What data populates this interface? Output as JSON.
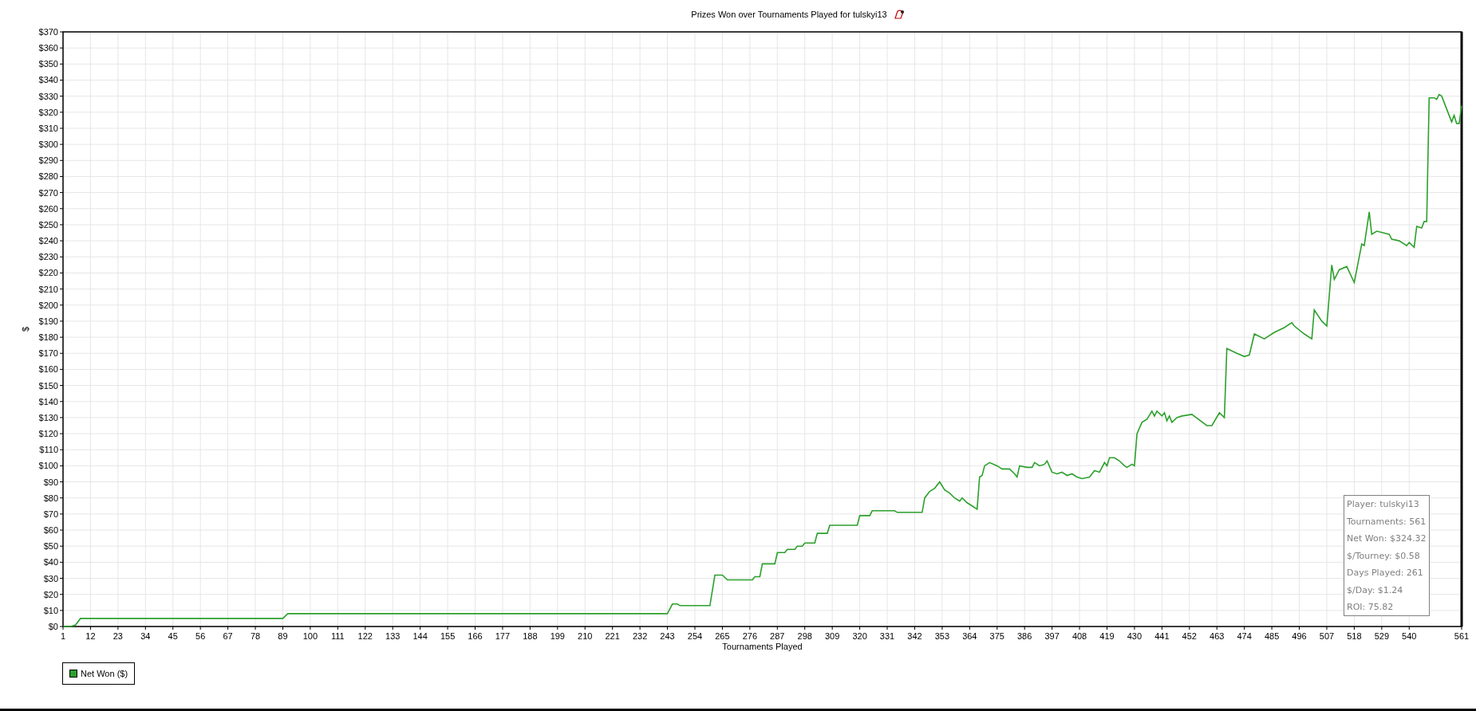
{
  "title": "Prizes Won over Tournaments Played for tulskyi13",
  "chart": {
    "chart_data": {
      "type": "line",
      "xlabel": "Tournaments Played",
      "ylabel": "$",
      "x": [
        1,
        4,
        6,
        8,
        89,
        91,
        243,
        245,
        247,
        248,
        260,
        262,
        265,
        267,
        277,
        278,
        280,
        281,
        286,
        287,
        290,
        291,
        294,
        295,
        297,
        298,
        302,
        303,
        307,
        308,
        319,
        320,
        324,
        325,
        334,
        335,
        345,
        346,
        348,
        350,
        352,
        354,
        356,
        358,
        360,
        361,
        363,
        365,
        367,
        368,
        369,
        370,
        372,
        375,
        377,
        380,
        382,
        383,
        384,
        387,
        389,
        390,
        392,
        394,
        395,
        397,
        399,
        401,
        403,
        405,
        407,
        409,
        412,
        414,
        416,
        418,
        419,
        420,
        422,
        424,
        426,
        427,
        429,
        430,
        431,
        433,
        435,
        437,
        438,
        439,
        441,
        442,
        443,
        444,
        445,
        447,
        449,
        453,
        459,
        461,
        464,
        466,
        467,
        471,
        474,
        476,
        478,
        482,
        486,
        490,
        493,
        494,
        498,
        501,
        502,
        505,
        507,
        509,
        510,
        512,
        515,
        518,
        521,
        522,
        524,
        525,
        527,
        532,
        533,
        536,
        539,
        540,
        542,
        543,
        545,
        546,
        547,
        548,
        550,
        551,
        552,
        553,
        557,
        558,
        559,
        560,
        561
      ],
      "series": [
        {
          "name": "Net Won ($)",
          "color": "#2ca02c",
          "values": [
            0,
            0,
            1,
            5,
            5,
            8,
            8,
            14,
            14,
            13,
            13,
            32,
            32,
            29,
            29,
            31,
            31,
            39,
            39,
            46,
            46,
            48,
            48,
            50,
            50,
            52,
            52,
            58,
            58,
            63,
            63,
            69,
            69,
            72,
            72,
            71,
            71,
            80,
            84,
            86,
            90,
            85,
            83,
            80,
            78,
            80,
            77,
            75,
            73,
            93,
            94,
            100,
            102,
            100,
            98,
            98,
            95,
            93,
            100,
            99,
            99,
            102,
            100,
            101,
            103,
            96,
            95,
            96,
            94,
            95,
            93,
            92,
            93,
            97,
            96,
            102,
            100,
            105,
            105,
            103,
            100,
            99,
            101,
            100,
            120,
            127,
            129,
            134,
            131,
            134,
            131,
            133,
            128,
            131,
            127,
            130,
            131,
            132,
            125,
            125,
            133,
            130,
            173,
            170,
            168,
            169,
            182,
            179,
            183,
            186,
            189,
            187,
            182,
            179,
            197,
            190,
            187,
            225,
            216,
            222,
            224,
            214,
            238,
            237,
            258,
            244,
            246,
            244,
            241,
            240,
            237,
            239,
            236,
            249,
            248,
            252,
            252,
            329,
            329,
            328,
            331,
            330,
            314,
            318,
            313,
            313,
            324
          ]
        }
      ],
      "grid": true,
      "xlim": [
        1,
        561
      ],
      "ylim": [
        0,
        370
      ],
      "xticks": [
        1,
        12,
        23,
        34,
        45,
        56,
        67,
        78,
        89,
        100,
        111,
        122,
        133,
        144,
        155,
        166,
        177,
        188,
        199,
        210,
        221,
        232,
        243,
        254,
        265,
        276,
        287,
        298,
        309,
        320,
        331,
        342,
        353,
        364,
        375,
        386,
        397,
        408,
        419,
        430,
        441,
        452,
        463,
        474,
        485,
        496,
        507,
        518,
        529,
        540,
        561
      ],
      "yticks": [
        {
          "value": 0,
          "label": "$0"
        },
        {
          "value": 10,
          "label": "$10"
        },
        {
          "value": 20,
          "label": "$20"
        },
        {
          "value": 30,
          "label": "$30"
        },
        {
          "value": 40,
          "label": "$40"
        },
        {
          "value": 50,
          "label": "$50"
        },
        {
          "value": 60,
          "label": "$60"
        },
        {
          "value": 70,
          "label": "$70"
        },
        {
          "value": 80,
          "label": "$80"
        },
        {
          "value": 90,
          "label": "$90"
        },
        {
          "value": 100,
          "label": "$100"
        },
        {
          "value": 110,
          "label": "$110"
        },
        {
          "value": 120,
          "label": "$120"
        },
        {
          "value": 130,
          "label": "$130"
        },
        {
          "value": 140,
          "label": "$140"
        },
        {
          "value": 150,
          "label": "$150"
        },
        {
          "value": 160,
          "label": "$160"
        },
        {
          "value": 170,
          "label": "$170"
        },
        {
          "value": 180,
          "label": "$180"
        },
        {
          "value": 190,
          "label": "$190"
        },
        {
          "value": 200,
          "label": "$200"
        },
        {
          "value": 210,
          "label": "$210"
        },
        {
          "value": 220,
          "label": "$220"
        },
        {
          "value": 230,
          "label": "$230"
        },
        {
          "value": 240,
          "label": "$240"
        },
        {
          "value": 250,
          "label": "$250"
        },
        {
          "value": 260,
          "label": "$260"
        },
        {
          "value": 270,
          "label": "$270"
        },
        {
          "value": 280,
          "label": "$280"
        },
        {
          "value": 290,
          "label": "$290"
        },
        {
          "value": 300,
          "label": "$300"
        },
        {
          "value": 310,
          "label": "$310"
        },
        {
          "value": 320,
          "label": "$320"
        },
        {
          "value": 330,
          "label": "$330"
        },
        {
          "value": 340,
          "label": "$340"
        },
        {
          "value": 350,
          "label": "$350"
        },
        {
          "value": 360,
          "label": "$360"
        },
        {
          "value": 370,
          "label": "$370"
        }
      ]
    },
    "stats_box": [
      "Player: tulskyi13",
      "Tournaments: 561",
      "Net Won: $324.32",
      "$/Tourney: $0.58",
      "Days Played: 261",
      "$/Day: $1.24",
      "ROI: 75.82"
    ]
  }
}
